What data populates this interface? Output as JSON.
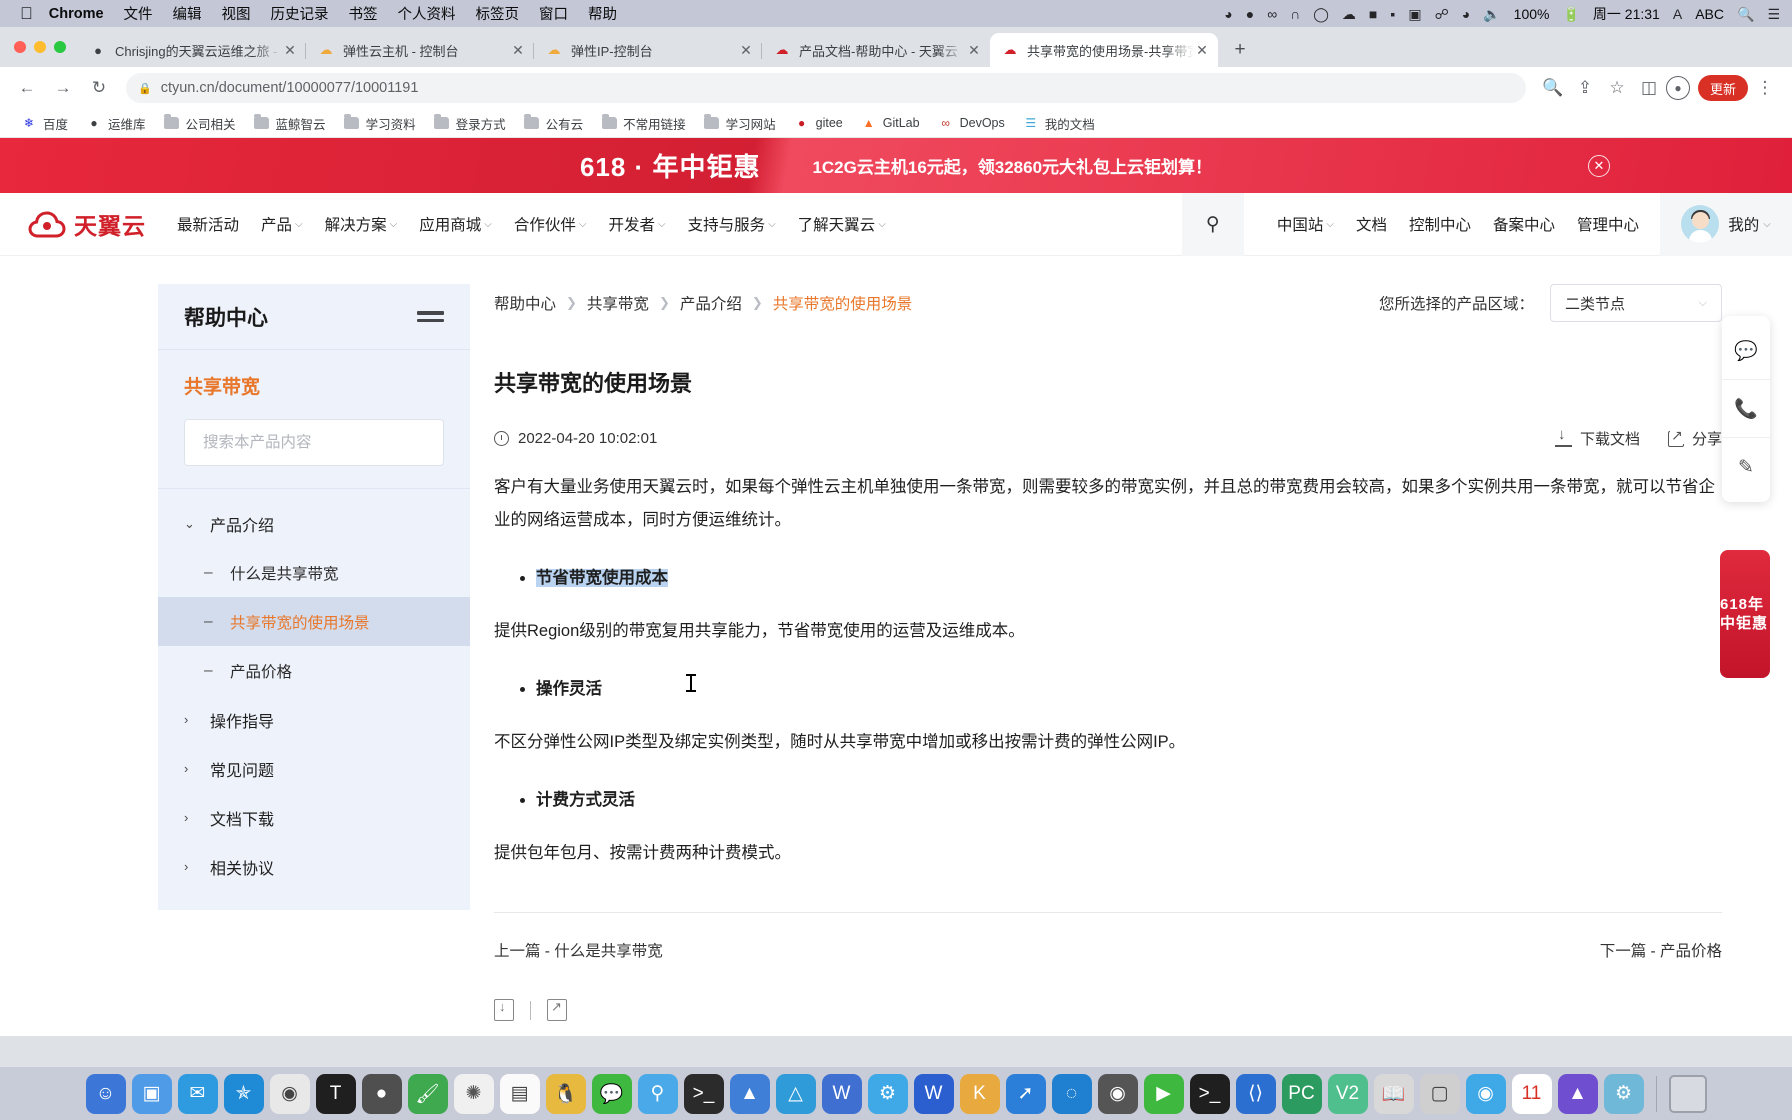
{
  "macos": {
    "app_name": "Chrome",
    "menus": [
      "文件",
      "编辑",
      "视图",
      "历史记录",
      "书签",
      "个人资料",
      "标签页",
      "窗口",
      "帮助"
    ],
    "status_icons": [
      "screen-record-icon",
      "dropbox-icon",
      "network-icon",
      "vpn-icon",
      "messages-icon",
      "cloud-icon",
      "display-icon",
      "camera-icon",
      "screen-icon",
      "bluetooth-icon",
      "wifi-icon",
      "volume-icon"
    ],
    "battery": "100%",
    "clock": "周一 21:31",
    "input_source": "ABC",
    "input_badge": "A"
  },
  "browser": {
    "tabs": [
      {
        "title": "Chrisjing的天翼云运维之旅 - Ch",
        "favicon": "penguin-icon",
        "active": false
      },
      {
        "title": "弹性云主机 - 控制台",
        "favicon": "cloud-orange-icon",
        "active": false
      },
      {
        "title": "弹性IP-控制台",
        "favicon": "cloud-orange-icon",
        "active": false
      },
      {
        "title": "产品文档-帮助中心 - 天翼云",
        "favicon": "ctyun-icon",
        "active": false
      },
      {
        "title": "共享带宽的使用场景-共享带宽-产",
        "favicon": "ctyun-icon",
        "active": true
      }
    ],
    "new_tab_label": "+",
    "url_host": "ctyun.cn",
    "url_path": "/document/10000077/10001191",
    "update_label": "更新",
    "bookmarks": [
      {
        "label": "百度",
        "icon": "baidu-icon"
      },
      {
        "label": "运维库",
        "icon": "globe-icon"
      },
      {
        "label": "公司相关",
        "icon": "folder-icon"
      },
      {
        "label": "蓝鲸智云",
        "icon": "folder-icon"
      },
      {
        "label": "学习资料",
        "icon": "folder-icon"
      },
      {
        "label": "登录方式",
        "icon": "folder-icon"
      },
      {
        "label": "公有云",
        "icon": "folder-icon"
      },
      {
        "label": "不常用链接",
        "icon": "folder-icon"
      },
      {
        "label": "学习网站",
        "icon": "folder-icon"
      },
      {
        "label": "gitee",
        "icon": "gitee-icon"
      },
      {
        "label": "GitLab",
        "icon": "gitlab-icon"
      },
      {
        "label": "DevOps",
        "icon": "devops-icon"
      },
      {
        "label": "我的文档",
        "icon": "docs-icon"
      }
    ]
  },
  "promo": {
    "headline": "618 · 年中钜惠",
    "subline": "1C2G云主机16元起，领32860元大礼包上云钜划算！",
    "close": "✕"
  },
  "site_header": {
    "brand": "天翼云",
    "nav": [
      {
        "label": "最新活动",
        "caret": false
      },
      {
        "label": "产品",
        "caret": true
      },
      {
        "label": "解决方案",
        "caret": true
      },
      {
        "label": "应用商城",
        "caret": true
      },
      {
        "label": "合作伙伴",
        "caret": true
      },
      {
        "label": "开发者",
        "caret": true
      },
      {
        "label": "支持与服务",
        "caret": true
      },
      {
        "label": "了解天翼云",
        "caret": true
      }
    ],
    "right_links": [
      {
        "label": "中国站",
        "caret": true
      },
      {
        "label": "文档",
        "caret": false
      },
      {
        "label": "控制中心",
        "caret": false
      },
      {
        "label": "备案中心",
        "caret": false
      },
      {
        "label": "管理中心",
        "caret": false
      }
    ],
    "account_label": "我的"
  },
  "sidebar": {
    "title": "帮助中心",
    "product": "共享带宽",
    "search_placeholder": "搜索本产品内容",
    "search_value": "",
    "groups": [
      {
        "label": "产品介绍",
        "expanded": true,
        "chevron": "⌄",
        "children": [
          {
            "label": "什么是共享带宽",
            "active": false
          },
          {
            "label": "共享带宽的使用场景",
            "active": true
          },
          {
            "label": "产品价格",
            "active": false
          }
        ]
      },
      {
        "label": "操作指导",
        "expanded": false,
        "chevron": "›",
        "children": []
      },
      {
        "label": "常见问题",
        "expanded": false,
        "chevron": "›",
        "children": []
      },
      {
        "label": "文档下载",
        "expanded": false,
        "chevron": "›",
        "children": []
      },
      {
        "label": "相关协议",
        "expanded": false,
        "chevron": "›",
        "children": []
      }
    ]
  },
  "main": {
    "breadcrumbs": [
      "帮助中心",
      "共享带宽",
      "产品介绍",
      "共享带宽的使用场景"
    ],
    "region_label": "您所选择的产品区域：",
    "region_value": "二类节点",
    "doc_title": "共享带宽的使用场景",
    "date": "2022-04-20 10:02:01",
    "download_label": "下载文档",
    "share_label": "分享",
    "paragraph1": "客户有大量业务使用天翼云时，如果每个弹性云主机单独使用一条带宽，则需要较多的带宽实例，并且总的带宽费用会较高，如果多个实例共用一条带宽，就可以节省企业的网络运营成本，同时方便运维统计。",
    "bullet1": "节省带宽使用成本",
    "paragraph2": "提供Region级别的带宽复用共享能力，节省带宽使用的运营及运维成本。",
    "bullet2": "操作灵活",
    "paragraph3": "不区分弹性公网IP类型及绑定实例类型，随时从共享带宽中增加或移出按需计费的弹性公网IP。",
    "bullet3": "计费方式灵活",
    "paragraph4": "提供包年包月、按需计费两种计费模式。",
    "prev_label": "上一篇 - 什么是共享带宽",
    "next_label": "下一篇 - 产品价格"
  },
  "rail": {
    "items": [
      "chat-icon",
      "phone-icon",
      "edit-icon"
    ],
    "promo_text": "618年中钜惠"
  },
  "colors": {
    "brand_red": "#d0202a",
    "accent_orange": "#e8772b",
    "sidebar_bg": "#eef2fa",
    "active_bg": "#d3dced",
    "selection_blue": "#b9d3f0"
  }
}
